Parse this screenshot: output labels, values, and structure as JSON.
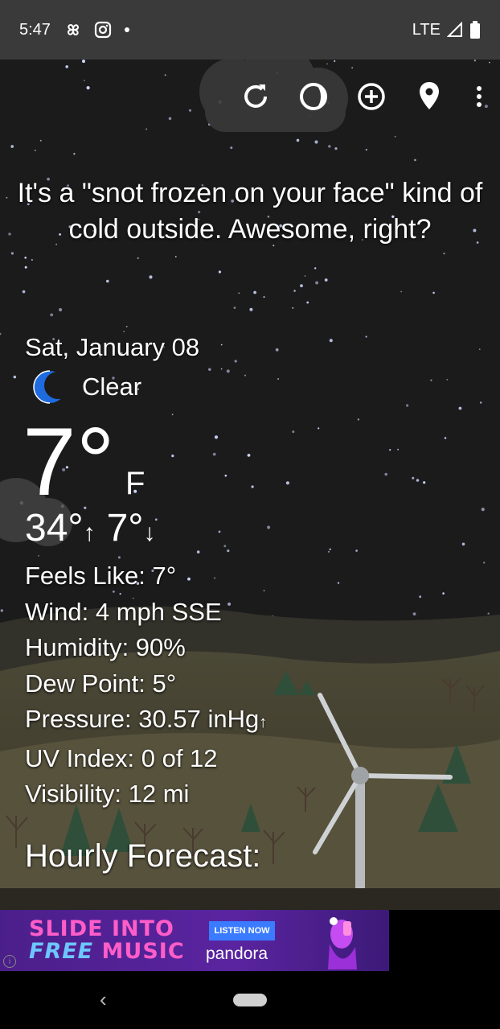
{
  "status_bar": {
    "time": "5:47",
    "network": "LTE",
    "icons": [
      "pinwheel-icon",
      "instagram-icon",
      "dot-icon",
      "signal-icon",
      "battery-icon"
    ]
  },
  "toolbar": {
    "icons": [
      "refresh-icon",
      "theme-icon",
      "add-location-icon",
      "location-pin-icon",
      "more-vert-icon"
    ]
  },
  "tagline": "It's a \"snot frozen on your face\" kind of cold outside. Awesome, right?",
  "weather": {
    "date": "Sat, January 08",
    "condition": "Clear",
    "condition_icon": "moon-icon",
    "temperature": "7°",
    "unit": "F",
    "high": "34°",
    "high_arrow": "↑",
    "low": "7°",
    "low_arrow": "↓"
  },
  "details": {
    "feels_like": "Feels Like:  7°",
    "wind": "Wind:  4 mph SSE",
    "humidity": "Humidity:  90%",
    "dew_point": "Dew Point:  5°",
    "pressure": "Pressure:  30.57 inHg",
    "pressure_arrow": "↑",
    "uv_index": "UV Index:  0 of 12",
    "visibility": "Visibility:  12 mi"
  },
  "hourly_heading": "Hourly Forecast:",
  "ad": {
    "headline_1": "SLIDE INTO",
    "headline_2a": "FREE",
    "headline_2b": "MUSIC",
    "button": "LISTEN NOW",
    "brand": "pandora",
    "info": "i"
  },
  "nav": {
    "back": "‹"
  },
  "colors": {
    "background": "#1b1b1b",
    "moon": "#1e6be0",
    "ad_pink": "#ff5dc8",
    "ad_blue": "#6ec6ff"
  }
}
